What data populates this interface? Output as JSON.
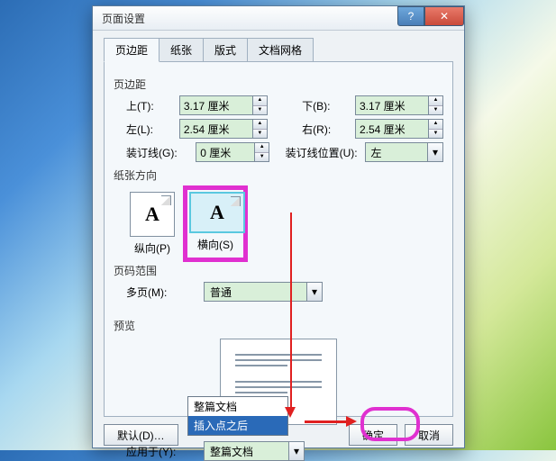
{
  "window": {
    "title": "页面设置"
  },
  "tabs": [
    "页边距",
    "纸张",
    "版式",
    "文档网格"
  ],
  "margins": {
    "group": "页边距",
    "top_label": "上(T):",
    "top_value": "3.17 厘米",
    "bottom_label": "下(B):",
    "bottom_value": "3.17 厘米",
    "left_label": "左(L):",
    "left_value": "2.54 厘米",
    "right_label": "右(R):",
    "right_value": "2.54 厘米",
    "gutter_label": "装订线(G):",
    "gutter_value": "0 厘米",
    "gutter_pos_label": "装订线位置(U):",
    "gutter_pos_value": "左"
  },
  "orientation": {
    "group": "纸张方向",
    "portrait": "纵向(P)",
    "landscape": "横向(S)"
  },
  "pages": {
    "group": "页码范围",
    "multi_label": "多页(M):",
    "multi_value": "普通"
  },
  "preview": {
    "group": "预览"
  },
  "apply": {
    "label": "应用于(Y):",
    "value": "整篇文档",
    "option2": "插入点之后"
  },
  "buttons": {
    "default": "默认(D)…",
    "ok": "确定",
    "cancel": "取消"
  }
}
